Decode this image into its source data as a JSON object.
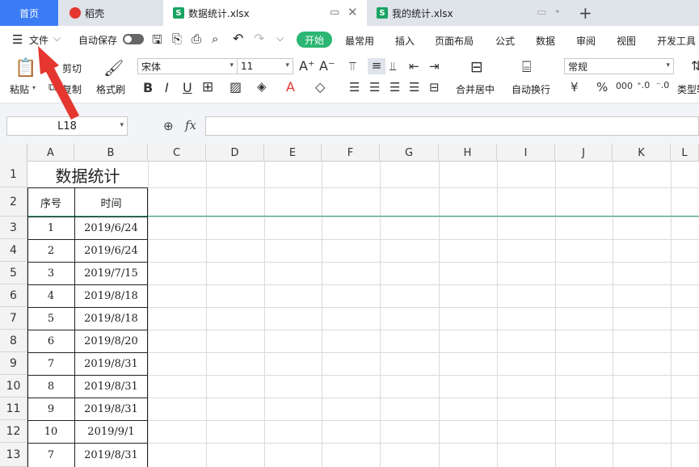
{
  "tabs": {
    "home": "首页",
    "daoke": "稻壳",
    "active_file": "数据统计.xlsx",
    "other_file": "我的统计.xlsx",
    "new_tab": "+"
  },
  "menu": {
    "file": "文件",
    "autosave": "自动保存",
    "start": "开始",
    "items": [
      "最常用",
      "插入",
      "页面布局",
      "公式",
      "数据",
      "审阅",
      "视图",
      "开发工具"
    ]
  },
  "ribbon": {
    "paste": "粘贴",
    "cut": "剪切",
    "copy": "复制",
    "format_painter": "格式刷",
    "font_name": "宋体",
    "font_size": "11",
    "merge_center": "合并居中",
    "wrap_text": "自动换行",
    "number_format": "常规",
    "type_convert": "类型转"
  },
  "formula_bar": {
    "name_box": "L18",
    "fx": "fx",
    "value": ""
  },
  "columns": [
    "A",
    "B",
    "C",
    "D",
    "E",
    "F",
    "G",
    "H",
    "I",
    "J",
    "K",
    "L"
  ],
  "rows": [
    "1",
    "2",
    "3",
    "4",
    "5",
    "6",
    "7",
    "8",
    "9",
    "10",
    "11",
    "12",
    "13"
  ],
  "sheet": {
    "title": "数据统计",
    "headers": [
      "序号",
      "时间"
    ],
    "data": [
      [
        "1",
        "2019/6/24"
      ],
      [
        "2",
        "2019/6/24"
      ],
      [
        "3",
        "2019/7/15"
      ],
      [
        "4",
        "2019/8/18"
      ],
      [
        "5",
        "2019/8/18"
      ],
      [
        "6",
        "2019/8/20"
      ],
      [
        "7",
        "2019/8/31"
      ],
      [
        "8",
        "2019/8/31"
      ],
      [
        "9",
        "2019/8/31"
      ],
      [
        "10",
        "2019/9/1"
      ],
      [
        "7",
        "2019/8/31"
      ]
    ]
  },
  "colors": {
    "accent_blue": "#3b7cf4",
    "start_green": "#2bb673",
    "arrow_red": "#e5362f"
  }
}
